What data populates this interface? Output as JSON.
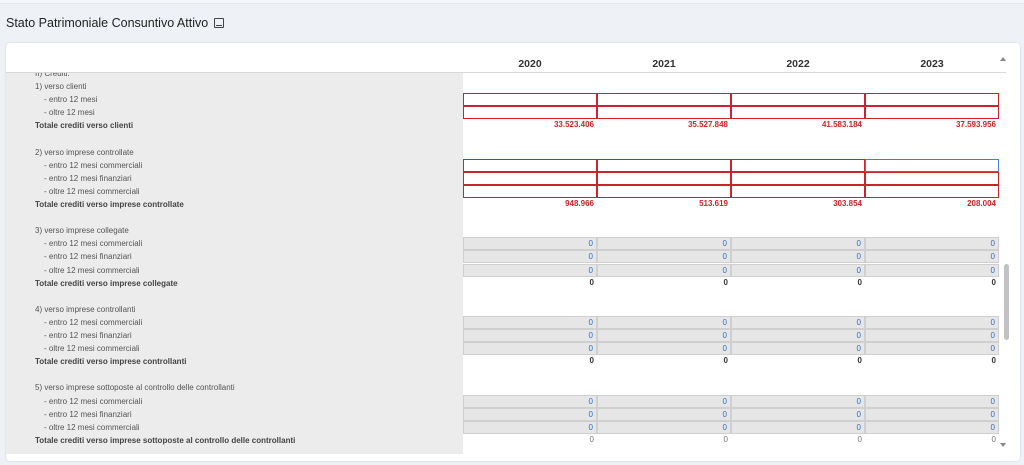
{
  "page": {
    "title": "Stato Patrimoniale Consuntivo Attivo",
    "title_icon": "book-icon"
  },
  "years": [
    "2020",
    "2021",
    "2022",
    "2023"
  ],
  "rows": [
    {
      "label": "II) Crediti:",
      "kind": "heading"
    },
    {
      "label": "1) verso clienti",
      "kind": "heading"
    },
    {
      "label": "- entro 12 mesi",
      "kind": "red",
      "values": [
        "",
        "",
        "",
        ""
      ]
    },
    {
      "label": "- oltre 12 mesi",
      "kind": "red",
      "values": [
        "",
        "",
        "",
        ""
      ]
    },
    {
      "label": "Totale crediti verso clienti",
      "kind": "total-red",
      "values": [
        "33.523.406",
        "35.527.848",
        "41.583.184",
        "37.593.956"
      ]
    },
    {
      "label": "",
      "kind": "blank"
    },
    {
      "label": "2) verso imprese controllate",
      "kind": "heading"
    },
    {
      "label": "- entro 12 mesi commerciali",
      "kind": "red",
      "values": [
        "",
        "",
        "",
        ""
      ],
      "focus": 3
    },
    {
      "label": "- entro 12 mesi finanziari",
      "kind": "red",
      "values": [
        "",
        "",
        "",
        ""
      ]
    },
    {
      "label": "- oltre 12 mesi commerciali",
      "kind": "red",
      "values": [
        "",
        "",
        "",
        ""
      ]
    },
    {
      "label": "Totale crediti verso imprese controllate",
      "kind": "total-red",
      "values": [
        "948.966",
        "513.619",
        "303.854",
        "208.004"
      ]
    },
    {
      "label": "",
      "kind": "blank"
    },
    {
      "label": "3) verso imprese collegate",
      "kind": "heading"
    },
    {
      "label": "- entro 12 mesi commerciali",
      "kind": "grey",
      "values": [
        "0",
        "0",
        "0",
        "0"
      ]
    },
    {
      "label": "- entro 12 mesi finanziari",
      "kind": "grey",
      "values": [
        "0",
        "0",
        "0",
        "0"
      ]
    },
    {
      "label": "- oltre 12 mesi commerciali",
      "kind": "grey",
      "values": [
        "0",
        "0",
        "0",
        "0"
      ]
    },
    {
      "label": "Totale crediti verso imprese collegate",
      "kind": "total-black",
      "values": [
        "0",
        "0",
        "0",
        "0"
      ]
    },
    {
      "label": "",
      "kind": "blank"
    },
    {
      "label": "4) verso imprese controllanti",
      "kind": "heading"
    },
    {
      "label": "- entro 12 mesi commerciali",
      "kind": "grey",
      "values": [
        "0",
        "0",
        "0",
        "0"
      ]
    },
    {
      "label": "- entro 12 mesi finanziari",
      "kind": "grey",
      "values": [
        "0",
        "0",
        "0",
        "0"
      ]
    },
    {
      "label": "- oltre 12 mesi commerciali",
      "kind": "grey",
      "values": [
        "0",
        "0",
        "0",
        "0"
      ]
    },
    {
      "label": "Totale crediti verso imprese controllanti",
      "kind": "total-black",
      "values": [
        "0",
        "0",
        "0",
        "0"
      ]
    },
    {
      "label": "",
      "kind": "blank"
    },
    {
      "label": "5) verso imprese sottoposte al controllo delle controllanti",
      "kind": "heading"
    },
    {
      "label": "- entro 12 mesi commerciali",
      "kind": "grey",
      "values": [
        "0",
        "0",
        "0",
        "0"
      ]
    },
    {
      "label": "- entro 12 mesi finanziari",
      "kind": "grey",
      "values": [
        "0",
        "0",
        "0",
        "0"
      ]
    },
    {
      "label": "- oltre 12 mesi commerciali",
      "kind": "grey",
      "values": [
        "0",
        "0",
        "0",
        "0"
      ]
    },
    {
      "label": "Totale crediti verso imprese sottoposte al controllo delle controllanti",
      "kind": "total-grey",
      "values": [
        "0",
        "0",
        "0",
        "0"
      ]
    }
  ]
}
